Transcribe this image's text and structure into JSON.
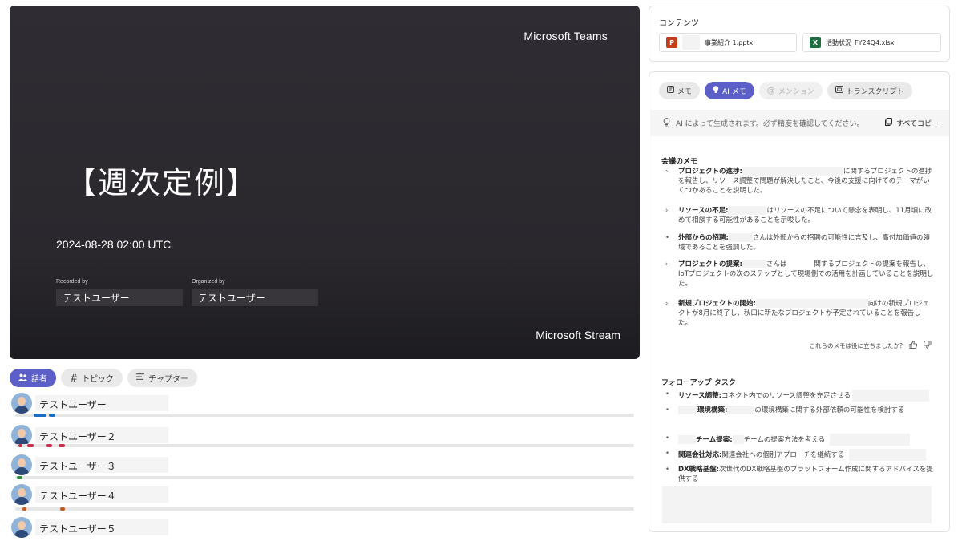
{
  "video": {
    "brand_top": "Microsoft Teams",
    "title": "【週次定例】",
    "date": "2024-08-28 02:00 UTC",
    "recorded_label": "Recorded by",
    "recorded_name": "テストユーザー",
    "organized_label": "Organized by",
    "organized_name": "テストユーザー",
    "brand_bottom": "Microsoft Stream"
  },
  "speaker_tabs": [
    {
      "label": "話者",
      "icon": "people-icon",
      "active": true
    },
    {
      "label": "トピック",
      "icon": "hash-icon",
      "active": false
    },
    {
      "label": "チャプター",
      "icon": "list-icon",
      "active": false
    }
  ],
  "speakers": [
    {
      "name": "テストユーザー",
      "color": "#1b6ec2",
      "activity": [
        [
          0.03,
          0.05
        ],
        [
          0.055,
          0.065
        ]
      ]
    },
    {
      "name": "テストユーザー２",
      "color": "#c4314b",
      "activity": [
        [
          0.005,
          0.012
        ],
        [
          0.02,
          0.03
        ],
        [
          0.05,
          0.06
        ],
        [
          0.07,
          0.08
        ]
      ]
    },
    {
      "name": "テストユーザー３",
      "color": "#2e8b3a",
      "activity": [
        [
          0.002,
          0.012
        ]
      ]
    },
    {
      "name": "テストユーザー４",
      "color": "#c75a1e",
      "activity": [
        [
          0.012,
          0.018
        ],
        [
          0.072,
          0.08
        ]
      ]
    },
    {
      "name": "テストユーザー５",
      "color": "#8a8a8a",
      "activity": []
    }
  ],
  "contents": {
    "title": "コンテンツ",
    "files": [
      {
        "name": "事業紹介 1.pptx",
        "icon": "powerpoint-icon",
        "badge": "P"
      },
      {
        "name": "活動状況_FY24Q4.xlsx",
        "icon": "excel-icon",
        "badge": "X"
      }
    ]
  },
  "notes": {
    "tabs": [
      {
        "label": "メモ",
        "icon": "note-icon",
        "state": "normal"
      },
      {
        "label": "AI メモ",
        "icon": "lightbulb-icon",
        "state": "active"
      },
      {
        "label": "メンション",
        "icon": "at-icon",
        "state": "disabled"
      },
      {
        "label": "トランスクリプト",
        "icon": "transcript-icon",
        "state": "normal"
      }
    ],
    "ai_disclaimer": "AI によって生成されます。必ず精度を確認してください。",
    "copy_all": "すべてコピー",
    "meeting_title": "会議のメモ",
    "meeting_items": [
      {
        "marker": "›",
        "head": "プロジェクトの進捗:",
        "text": "に関するプロジェクトの進捗を報告し、リソース調整で問題が解決したこと、今後の支援に向けてのテーマがいくつかあることを説明した。"
      },
      {
        "marker": "›",
        "head": "リソースの不足:",
        "text": "はリソースの不足について懸念を表明し、11月頃に改めて相談する可能性があることを示唆した。"
      },
      {
        "marker": "•",
        "head": "外部からの招聘:",
        "text": "さんは外部からの招聘の可能性に言及し、高付加価値の領域であることを強調した。"
      },
      {
        "marker": "›",
        "head": "プロジェクトの提案:",
        "text": "さんは　　　　関するプロジェクトの提案を報告し、IoTプロジェクトの次のステップとして現場側での活用を計画していることを説明した。"
      },
      {
        "marker": "›",
        "head": "新規プロジェクトの開始:",
        "text": "向けの新規プロジェクトが8月に終了し、秋口に新たなプロジェクトが予定されていることを報告した。"
      }
    ],
    "feedback_question": "これらのメモは役に立ちましたか?",
    "followup_title": "フォローアップ タスク",
    "followup_items": [
      {
        "head": "リソース調整:",
        "text": "コネクト内でのリソース調整を充足させる"
      },
      {
        "head": "環境構築:",
        "text": "の環境構築に関する外部依頼の可能性を検討する"
      },
      {
        "head": "チーム提案:",
        "text": "チームの提案方法を考える"
      },
      {
        "head": "関連会社対応:",
        "text": "関連会社への個別アプローチを継続する"
      },
      {
        "head": "DX戦略基盤:",
        "text": "次世代のDX戦略基盤のプラットフォーム作成に関するアドバイスを提供する"
      }
    ]
  },
  "colors": {
    "accent": "#5b5fc7",
    "video_bg": "#2f2d33"
  }
}
